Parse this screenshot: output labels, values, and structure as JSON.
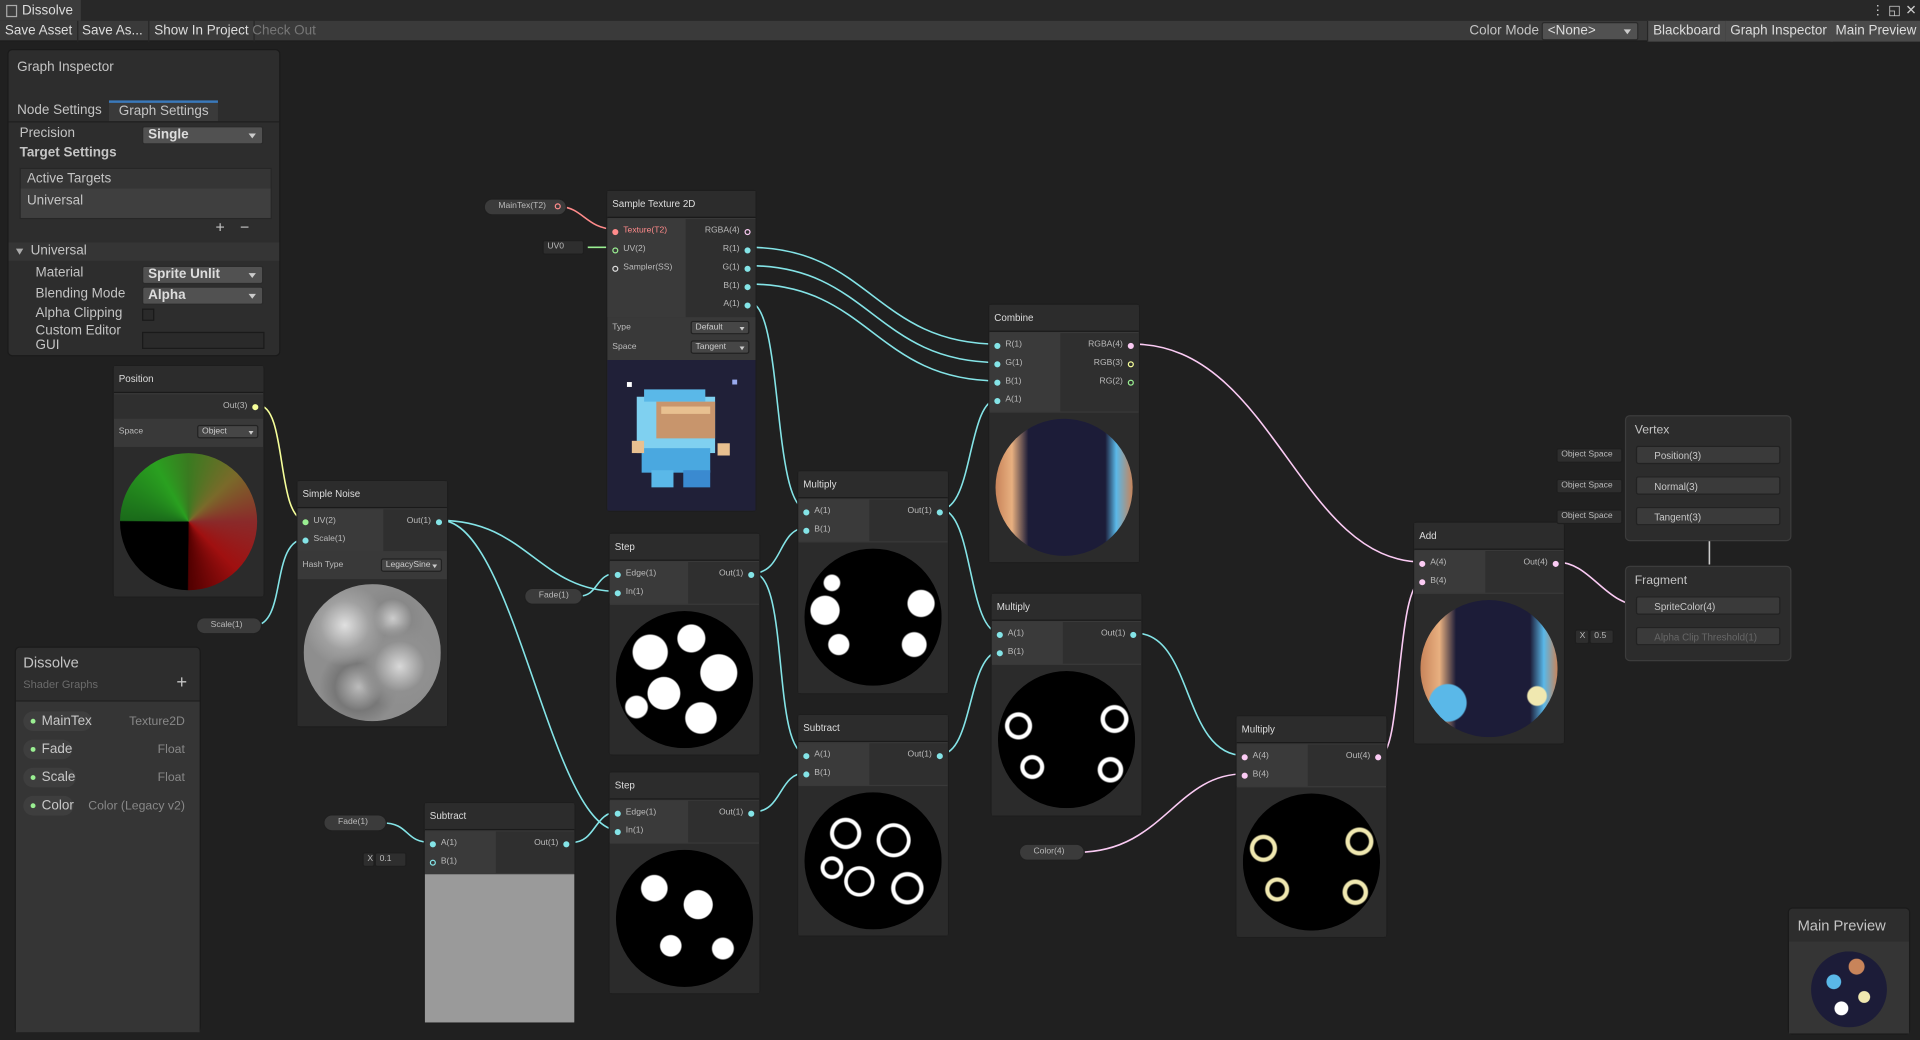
{
  "window": {
    "tab_title": "Dissolve"
  },
  "toolbar": {
    "save_asset": "Save Asset",
    "save_as": "Save As...",
    "show_in_project": "Show In Project",
    "check_out": "Check Out",
    "color_mode_label": "Color Mode",
    "color_mode_value": "<None>",
    "blackboard": "Blackboard",
    "graph_inspector": "Graph Inspector",
    "main_preview": "Main Preview"
  },
  "inspector": {
    "title": "Graph Inspector",
    "tabs": [
      "Node Settings",
      "Graph Settings"
    ],
    "precision_label": "Precision",
    "precision_value": "Single",
    "target_settings": "Target Settings",
    "active_targets": "Active Targets",
    "target_item": "Universal",
    "add": "+",
    "remove": "−",
    "section": "Universal",
    "material_label": "Material",
    "material_value": "Sprite Unlit",
    "blending_label": "Blending Mode",
    "blending_value": "Alpha",
    "alpha_clipping_label": "Alpha Clipping",
    "custom_editor_label": "Custom Editor GUI",
    "custom_editor_value": ""
  },
  "blackboard": {
    "title": "Dissolve",
    "subtitle": "Shader Graphs",
    "add": "+",
    "properties": [
      {
        "name": "MainTex",
        "type": "Texture2D"
      },
      {
        "name": "Fade",
        "type": "Float"
      },
      {
        "name": "Scale",
        "type": "Float"
      },
      {
        "name": "Color",
        "type": "Color (Legacy v2)"
      }
    ]
  },
  "nodes": {
    "sample_texture": {
      "title": "Sample Texture 2D",
      "in": [
        "Texture(T2)",
        "UV(2)",
        "Sampler(SS)"
      ],
      "out": [
        "RGBA(4)",
        "R(1)",
        "G(1)",
        "B(1)",
        "A(1)"
      ],
      "type_label": "Type",
      "type_value": "Default",
      "space_label": "Space",
      "space_value": "Tangent"
    },
    "position": {
      "title": "Position",
      "out": "Out(3)",
      "space_label": "Space",
      "space_value": "Object"
    },
    "simple_noise": {
      "title": "Simple Noise",
      "in": [
        "UV(2)",
        "Scale(1)"
      ],
      "out": "Out(1)",
      "hash_label": "Hash Type",
      "hash_value": "LegacySine"
    },
    "step1": {
      "title": "Step",
      "in": [
        "Edge(1)",
        "In(1)"
      ],
      "out": "Out(1)"
    },
    "step2": {
      "title": "Step",
      "in": [
        "Edge(1)",
        "In(1)"
      ],
      "out": "Out(1)"
    },
    "subtract1": {
      "title": "Subtract",
      "in": [
        "A(1)",
        "B(1)"
      ],
      "out": "Out(1)"
    },
    "subtract2": {
      "title": "Subtract",
      "in": [
        "A(1)",
        "B(1)"
      ],
      "out": "Out(1)"
    },
    "multiply1": {
      "title": "Multiply",
      "in": [
        "A(1)",
        "B(1)"
      ],
      "out": "Out(1)"
    },
    "multiply2": {
      "title": "Multiply",
      "in": [
        "A(1)",
        "B(1)"
      ],
      "out": "Out(1)"
    },
    "multiply3": {
      "title": "Multiply",
      "in": [
        "A(4)",
        "B(4)"
      ],
      "out": "Out(4)"
    },
    "combine": {
      "title": "Combine",
      "in": [
        "R(1)",
        "G(1)",
        "B(1)",
        "A(1)"
      ],
      "out": [
        "RGBA(4)",
        "RGB(3)",
        "RG(2)"
      ]
    },
    "add": {
      "title": "Add",
      "in": [
        "A(4)",
        "B(4)"
      ],
      "out": "Out(4)"
    }
  },
  "props": {
    "maintex": "MainTex(T2)",
    "uv": "UV0",
    "fade1": "Fade(1)",
    "fade2": "Fade(1)",
    "scale": "Scale(1)",
    "color": "Color(4)",
    "x_label": "X",
    "sub_b": "0.1",
    "alpha_x": "X",
    "alpha_val": "0.5"
  },
  "master": {
    "vertex_title": "Vertex",
    "vertex_ports": [
      "Position(3)",
      "Normal(3)",
      "Tangent(3)"
    ],
    "object_space": "Object Space",
    "fragment_title": "Fragment",
    "fragment_ports": [
      "SpriteColor(4)",
      "Alpha Clip Threshold(1)"
    ]
  },
  "main_preview": {
    "title": "Main Preview"
  },
  "colors": {
    "wire_float": "#84e4e7",
    "wire_vec3": "#f6ff9a",
    "wire_vec4": "#fbcbf4",
    "wire_texture": "#ff8b8b"
  }
}
